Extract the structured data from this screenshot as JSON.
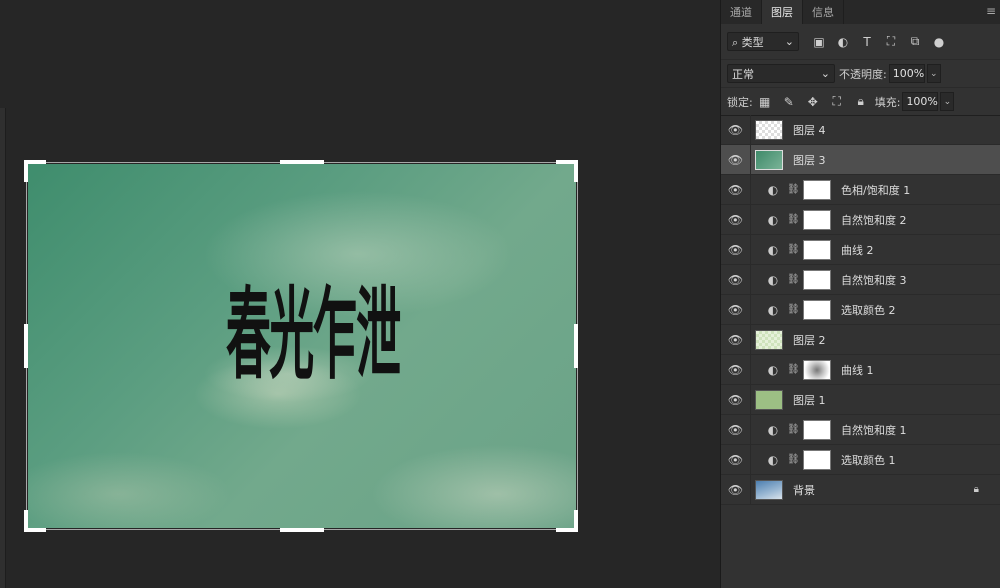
{
  "canvas": {
    "image_title": "春光乍泄"
  },
  "panel": {
    "tabs": [
      "通道",
      "图层",
      "信息"
    ],
    "active_tab": "图层",
    "filter": {
      "kind_label": "类型",
      "icons": [
        "image-filter-icon",
        "adjustment-filter-icon",
        "type-filter-icon",
        "shape-filter-icon",
        "smart-object-filter-icon",
        "filter-toggle-icon"
      ]
    },
    "blend": {
      "mode": "正常",
      "opacity_label": "不透明度:",
      "opacity_value": "100%"
    },
    "lock": {
      "label": "锁定:",
      "fill_label": "填充:",
      "fill_value": "100%"
    },
    "layers": [
      {
        "name": "图层 4",
        "type": "pixel",
        "thumb": "transparent-text"
      },
      {
        "name": "图层 3",
        "type": "pixel",
        "thumb": "green-cloud",
        "selected": true
      },
      {
        "name": "色相/饱和度 1",
        "type": "adjustment"
      },
      {
        "name": "自然饱和度 2",
        "type": "adjustment"
      },
      {
        "name": "曲线 2",
        "type": "adjustment"
      },
      {
        "name": "自然饱和度 3",
        "type": "adjustment"
      },
      {
        "name": "选取颜色 2",
        "type": "adjustment"
      },
      {
        "name": "图层 2",
        "type": "pixel",
        "thumb": "light-green"
      },
      {
        "name": "曲线 1",
        "type": "adjustment",
        "mask": "soft"
      },
      {
        "name": "图层 1",
        "type": "pixel",
        "thumb": "solid-green"
      },
      {
        "name": "自然饱和度 1",
        "type": "adjustment"
      },
      {
        "name": "选取颜色 1",
        "type": "adjustment"
      },
      {
        "name": "背景",
        "type": "background",
        "thumb": "sky",
        "locked": true
      }
    ]
  },
  "colors": {
    "panel_bg": "#323232",
    "canvas_bg": "#262626",
    "selected_row": "#4e4e4e",
    "image_green": "#4f9576",
    "layer1_fill": "#9cbf84"
  }
}
